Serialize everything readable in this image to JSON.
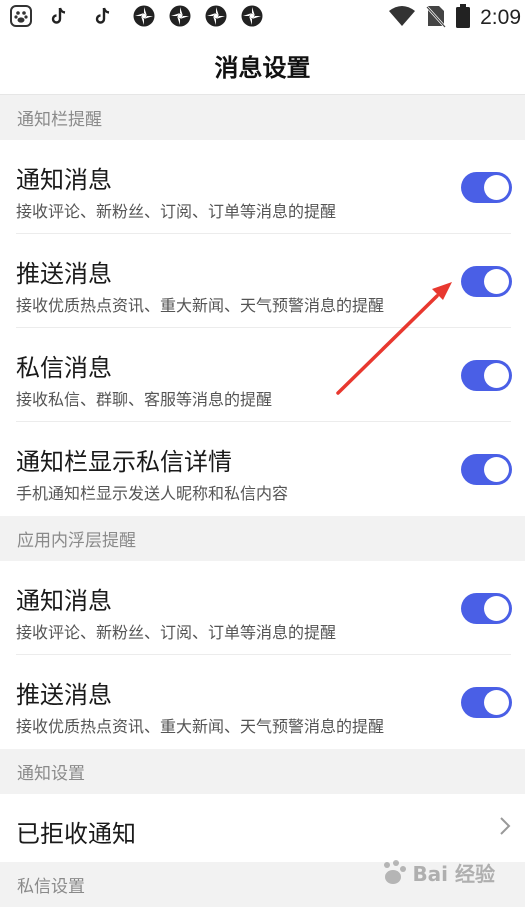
{
  "status_bar": {
    "time": "2:09",
    "icons": [
      "baidu-app-icon",
      "tiktok-icon",
      "tiktok-icon",
      "aperture-icon",
      "aperture-icon",
      "aperture-icon",
      "aperture-icon"
    ],
    "right_icons": [
      "wifi-icon",
      "no-sim-icon",
      "battery-icon"
    ]
  },
  "header": {
    "title": "消息设置"
  },
  "sections": {
    "notification_bar": {
      "header": "通知栏提醒",
      "items": [
        {
          "title": "通知消息",
          "desc": "接收评论、新粉丝、订阅、订单等消息的提醒",
          "enabled": true
        },
        {
          "title": "推送消息",
          "desc": "接收优质热点资讯、重大新闻、天气预警消息的提醒",
          "enabled": true
        },
        {
          "title": "私信消息",
          "desc": "接收私信、群聊、客服等消息的提醒",
          "enabled": true
        },
        {
          "title": "通知栏显示私信详情",
          "desc": "手机通知栏显示发送人昵称和私信内容",
          "enabled": true
        }
      ]
    },
    "in_app": {
      "header": "应用内浮层提醒",
      "items": [
        {
          "title": "通知消息",
          "desc": "接收评论、新粉丝、订阅、订单等消息的提醒",
          "enabled": true
        },
        {
          "title": "推送消息",
          "desc": "接收优质热点资讯、重大新闻、天气预警消息的提醒",
          "enabled": true
        }
      ]
    },
    "notification_settings": {
      "header": "通知设置",
      "rejected_label": "已拒收通知"
    },
    "private_message": {
      "header": "私信设置"
    }
  },
  "watermark": {
    "text": "Bai 经验",
    "paw_letter": "du"
  },
  "colors": {
    "toggle_on": "#4a5fe6",
    "annotation_arrow": "#e8382f",
    "section_bg": "#f2f2f2"
  }
}
